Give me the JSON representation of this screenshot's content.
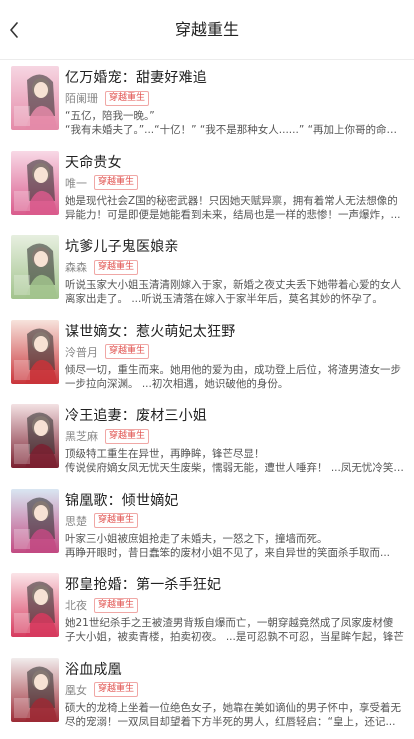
{
  "header": {
    "title": "穿越重生"
  },
  "books": [
    {
      "title": "亿万婚宠：甜妻好难追",
      "author": "陌阑珊",
      "tag": "穿越重生",
      "desc": [
        "“五亿，陪我一晚。”",
        "“我有未婚夫了。”...“十亿！” “我不是那种女人......” “再加上你哥的命和你莫"
      ],
      "cover_colors": [
        "#f6d6e2",
        "#e48aa8"
      ]
    },
    {
      "title": "天命贵女",
      "author": "唯一",
      "tag": "穿越重生",
      "desc": [
        "她是现代社会Z国的秘密武器！只因她天赋异禀，拥有着常人无法想像的",
        "异能力！可是即便是她能看到未来，结局也是一样的悲惨！一声爆炸，..."
      ],
      "cover_colors": [
        "#f8d9e6",
        "#d95b8c"
      ]
    },
    {
      "title": "坑爹儿子鬼医娘亲",
      "author": "森森",
      "tag": "穿越重生",
      "desc": [
        "听说玉家大小姐玉清清刚嫁入于家，新婚之夜丈夫丢下她带着心爱的女人",
        "离家出走了。 ...听说玉清落在嫁入于家半年后，莫名其妙的怀孕了。"
      ],
      "cover_colors": [
        "#e7efe0",
        "#a2c38d"
      ]
    },
    {
      "title": "谋世嫡女：惹火萌妃太狂野",
      "author": "泠普月",
      "tag": "穿越重生",
      "desc": [
        "倾尽一切，重生而来。她用他的爱为由，成功登上后位，将渣男渣女一步",
        "一步拉向深渊。 ...初次相遇，她识破他的身份。"
      ],
      "cover_colors": [
        "#f7e3dc",
        "#c9343a"
      ]
    },
    {
      "title": "冷王追妻：废材三小姐",
      "author": "黑芝麻",
      "tag": "穿越重生",
      "desc": [
        "顶级特工重生在异世，再睁眸，锋芒尽显！",
        "传说侯府嫡女凤无忧天生废柴，懦弱无能，遭世人唾弃！ ...凤无忧冷笑，i"
      ],
      "cover_colors": [
        "#f3e1e3",
        "#7a2030"
      ]
    },
    {
      "title": "锦凰歌：倾世嫡妃",
      "author": "思楚",
      "tag": "穿越重生",
      "desc": [
        "叶家三小姐被庶姐抢走了未婚夫，一怒之下，撞墙而死。",
        "再睁开眼时，昔日蠢笨的废材小姐不见了，来自异世的笑面杀手取而..."
      ],
      "cover_colors": [
        "#d9e6f2",
        "#c24a82"
      ]
    },
    {
      "title": "邪皇抢婚：第一杀手狂妃",
      "author": "北夜",
      "tag": "穿越重生",
      "desc": [
        "她21世纪杀手之王被渣男背叛自爆而亡，一朝穿越竟然成了凤家废材傻",
        "子大小姐，被卖青楼，拍卖初夜。 ...是可忍孰不可忍，当星眸乍起，锋芒"
      ],
      "cover_colors": [
        "#fbe4e8",
        "#d63a5e"
      ]
    },
    {
      "title": "浴血成凰",
      "author": "凰女",
      "tag": "穿越重生",
      "desc": [
        "硕大的龙椅上坐着一位绝色女子，她靠在美如谪仙的男子怀中，享受着无",
        "尽的宠溺！一双凤目却望着下方半死的男人，红唇轻启：“皇上，还记..."
      ],
      "cover_colors": [
        "#f1ecec",
        "#9c2a35"
      ]
    }
  ]
}
